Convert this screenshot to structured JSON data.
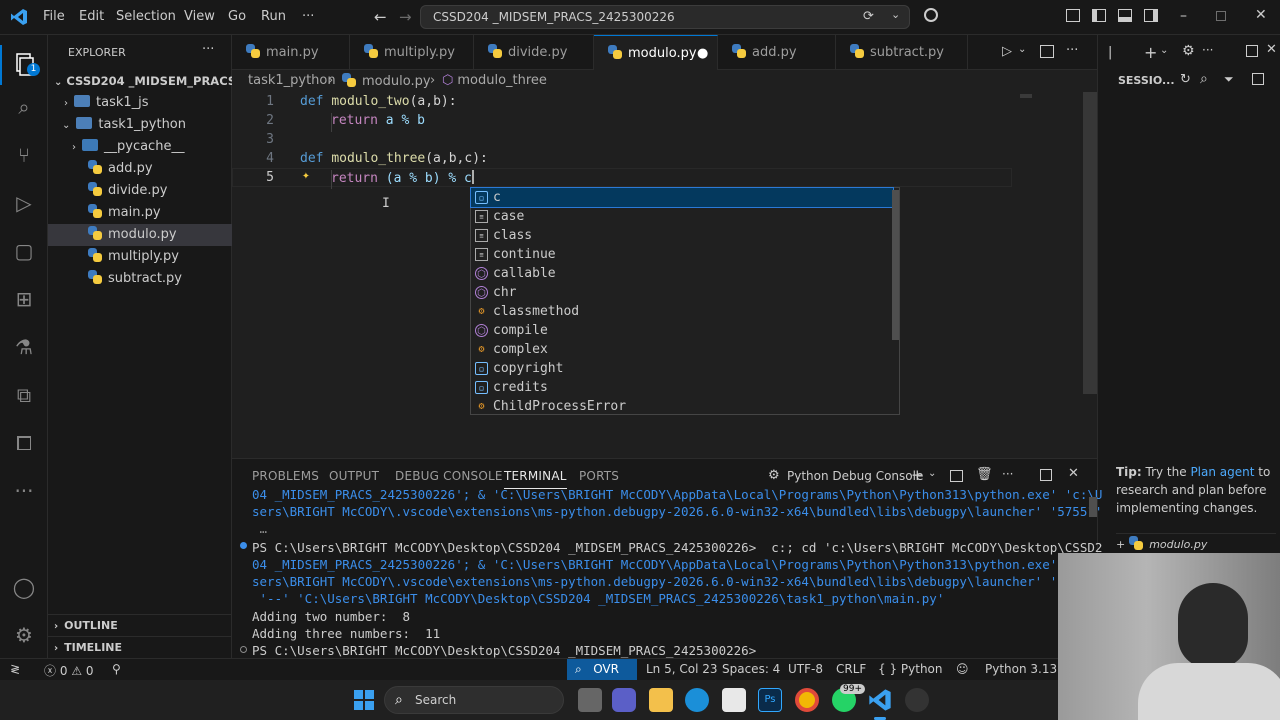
{
  "menu": [
    "File",
    "Edit",
    "Selection",
    "View",
    "Go",
    "Run",
    "···"
  ],
  "command_center": "CSSD204 _MIDSEM_PRACS_2425300226",
  "explorer": {
    "title": "EXPLORER",
    "root": "CSSD204 _MIDSEM_PRACS_2...",
    "items": [
      {
        "label": "task1_js",
        "type": "folder-collapsed"
      },
      {
        "label": "task1_python",
        "type": "folder-open"
      },
      {
        "label": "__pycache__",
        "type": "folder-collapsed"
      },
      {
        "label": "add.py",
        "type": "python"
      },
      {
        "label": "divide.py",
        "type": "python"
      },
      {
        "label": "main.py",
        "type": "python"
      },
      {
        "label": "modulo.py",
        "type": "python",
        "selected": true
      },
      {
        "label": "multiply.py",
        "type": "python"
      },
      {
        "label": "subtract.py",
        "type": "python"
      }
    ],
    "outline": "OUTLINE",
    "timeline": "TIMELINE"
  },
  "tabs": [
    {
      "label": "main.py"
    },
    {
      "label": "multiply.py"
    },
    {
      "label": "divide.py"
    },
    {
      "label": "modulo.py",
      "active": true,
      "modified": "●"
    },
    {
      "label": "add.py"
    },
    {
      "label": "subtract.py"
    }
  ],
  "breadcrumb": {
    "folder": "task1_python",
    "file": "modulo.py",
    "symbol": "modulo_three"
  },
  "editor": {
    "lines": [
      {
        "n": "1",
        "kw": "def",
        "fn": "modulo_two",
        "rest": "(a,b):"
      },
      {
        "n": "2",
        "kw": "return",
        "rest": " a % b"
      },
      {
        "n": "3"
      },
      {
        "n": "4",
        "kw": "def",
        "fn": "modulo_three",
        "rest": "(a,b,c):"
      },
      {
        "n": "5",
        "kw": "return",
        "rest": " (a % b) % c"
      }
    ]
  },
  "suggestions": [
    {
      "label": "c",
      "kind": "var"
    },
    {
      "label": "case",
      "kind": "kw"
    },
    {
      "label": "class",
      "kind": "kw"
    },
    {
      "label": "continue",
      "kind": "kw"
    },
    {
      "label": "callable",
      "kind": "fn"
    },
    {
      "label": "chr",
      "kind": "fn"
    },
    {
      "label": "classmethod",
      "kind": "cls"
    },
    {
      "label": "compile",
      "kind": "fn"
    },
    {
      "label": "complex",
      "kind": "cls"
    },
    {
      "label": "copyright",
      "kind": "var"
    },
    {
      "label": "credits",
      "kind": "var"
    },
    {
      "label": "ChildProcessError",
      "kind": "cls"
    }
  ],
  "panel": {
    "tabs": [
      "PROBLEMS",
      "OUTPUT",
      "DEBUG CONSOLE",
      "TERMINAL",
      "PORTS"
    ],
    "active_tab": "TERMINAL",
    "terminal_profile": "Python Debug Console",
    "lines": [
      "04 _MIDSEM_PRACS_2425300226'; & 'C:\\Users\\BRIGHT McCODY\\AppData\\Local\\Programs\\Python\\Python313\\python.exe' 'c:\\U",
      "sers\\BRIGHT McCODY\\.vscode\\extensions\\ms-python.debugpy-2026.6.0-win32-x64\\bundled\\libs\\debugpy\\launcher' '57551'",
      " …",
      "PS C:\\Users\\BRIGHT McCODY\\Desktop\\CSSD204 _MIDSEM_PRACS_2425300226>  c:; cd 'c:\\Users\\BRIGHT McCODY\\Desktop\\CSSD2",
      "04 _MIDSEM_PRACS_2425300226'; & 'C:\\Users\\BRIGHT McCODY\\AppData\\Local\\Programs\\Python\\Python313\\python.exe' 'c:\\U",
      "sers\\BRIGHT McCODY\\.vscode\\extensions\\ms-python.debugpy-2026.6.0-win32-x64\\bundled\\libs\\debugpy\\launcher' '575",
      " '--' 'C:\\Users\\BRIGHT McCODY\\Desktop\\CSSD204 _MIDSEM_PRACS_2425300226\\task1_python\\main.py'",
      "Adding two number:  8",
      "Adding three numbers:  11",
      "PS C:\\Users\\BRIGHT McCODY\\Desktop\\CSSD204 _MIDSEM_PRACS_2425300226> "
    ]
  },
  "right_panel": {
    "title": "SESSIO...",
    "tip_bold": "Tip:",
    "tip_pre": " Try the ",
    "tip_link": "Plan agent",
    "tip_post": " to research and plan before implementing changes.",
    "context_file": "modulo.py"
  },
  "statusbar": {
    "errors": "0",
    "warnings": "0",
    "mode": "OVR",
    "position": "Ln 5, Col 23",
    "spaces": "Spaces: 4",
    "encoding": "UTF-8",
    "eol": "CRLF",
    "language": "Python",
    "interpreter": "Python 3.13 (6"
  },
  "taskbar": {
    "search": "Search",
    "badge": "99+"
  }
}
